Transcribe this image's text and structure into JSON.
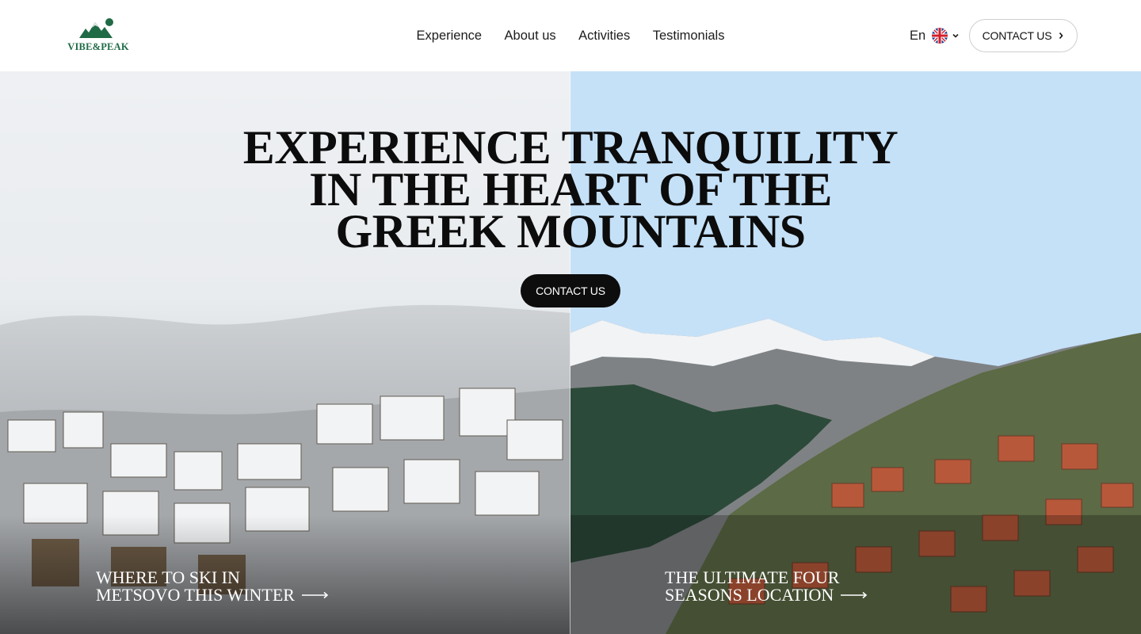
{
  "header": {
    "logo_text": "VIBE&PEAK",
    "nav": [
      "Experience",
      "About us",
      "Activities",
      "Testimonials"
    ],
    "language": "En",
    "contact_label": "CONTACT US"
  },
  "hero": {
    "title_lines": [
      "EXPERIENCE TRANQUILITY",
      "IN THE HEART OF THE",
      "GREEK MOUNTAINS"
    ],
    "cta_label": "CONTACT US",
    "left_link": {
      "line1": "WHERE TO SKI IN",
      "line2": "METSOVO THIS WINTER"
    },
    "right_link": {
      "line1": "THE ULTIMATE FOUR",
      "line2": "SEASONS LOCATION"
    }
  },
  "colors": {
    "brand_green": "#1f6b46",
    "sky_blue": "#c5e1f8",
    "cta_dark": "#0d0d0d"
  },
  "icons": [
    "mountain-logo-icon",
    "uk-flag-icon",
    "chevron-down-icon",
    "chevron-right-icon",
    "long-arrow-right-icon"
  ]
}
